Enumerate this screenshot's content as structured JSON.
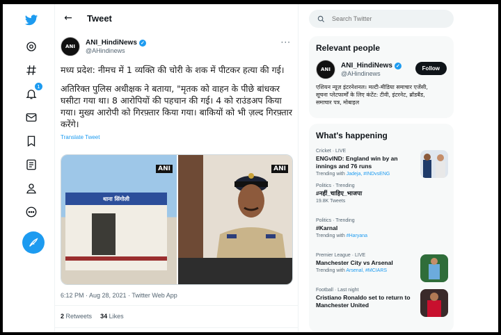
{
  "nav": {
    "items": [
      "twitter-logo",
      "explore",
      "hashtag",
      "notifications",
      "messages",
      "bookmarks",
      "lists",
      "profile",
      "more"
    ],
    "notification_count": "1",
    "accent": "#1d9bf0"
  },
  "header": {
    "title": "Tweet"
  },
  "tweet": {
    "author_name": "ANI_HindiNews",
    "author_handle": "@AHindinews",
    "logo_text": "ANI",
    "paragraph1": "मध्य प्रदेश: नीमच में 1 व्यक्ति की चोरी के शक में पीटकर हत्या की गई।",
    "paragraph2": "अतिरिक्त पुलिस अधीक्षक ने बताया, \"मृतक को वाहन के पीछे बांधकर घसीटा गया था। 8 आरोपियों की पहचान की गई। 4 को राउंडअप किया गया। मुख्य आरोपी को गिरफ़्तार किया गया। बाकियों को भी ज़ल्द गिरफ़्तार करेंगे।",
    "translate_label": "Translate Tweet",
    "media": {
      "left_tag": "ANI",
      "right_tag": "ANI",
      "station_sign": "थाना सिंगोली"
    },
    "timestamp": "6:12 PM · Aug 28, 2021 · Twitter Web App",
    "retweets_count": "2",
    "retweets_label": "Retweets",
    "likes_count": "34",
    "likes_label": "Likes"
  },
  "search": {
    "placeholder": "Search Twitter"
  },
  "relevant": {
    "title": "Relevant people",
    "name": "ANI_HindiNews",
    "handle": "@AHindinews",
    "follow_label": "Follow",
    "bio": "एशियन न्यूज़ इंटरनेशनल। मल्टी-मीडिया समाचार एजेंसी, सूचना प्लेटफार्मों के लिए कंटेंट: टीवी, इंटरनेट, ब्रॉडबैंड, समाचार पत्र, मोबाइल"
  },
  "happening": {
    "title": "What's happening",
    "trends": [
      {
        "category": "Cricket · LIVE",
        "title": "ENGvIND: England win by an innings and 76 runs",
        "sub_prefix": "Trending with",
        "sub_links": "Jadeja, #INDvsENG",
        "thumb": "cricket-photo"
      },
      {
        "category": "Politics · Trending",
        "title": "#नहीं_चाहिए_भाजपा",
        "sub_prefix": "",
        "sub_links": "",
        "sub_plain": "19.8K Tweets"
      },
      {
        "category": "Politics · Trending",
        "title": "#Karnal",
        "sub_prefix": "Trending with",
        "sub_links": "#Haryana"
      },
      {
        "category": "Premier League · LIVE",
        "title": "Manchester City vs Arsenal",
        "sub_prefix": "Trending with",
        "sub_links": "Arsenal, #MCIARS",
        "thumb": "football-photo"
      },
      {
        "category": "Football · Last night",
        "title": "Cristiano Ronaldo set to return to Manchester United",
        "sub_prefix": "",
        "sub_links": "",
        "thumb": "ronaldo-photo"
      }
    ]
  }
}
